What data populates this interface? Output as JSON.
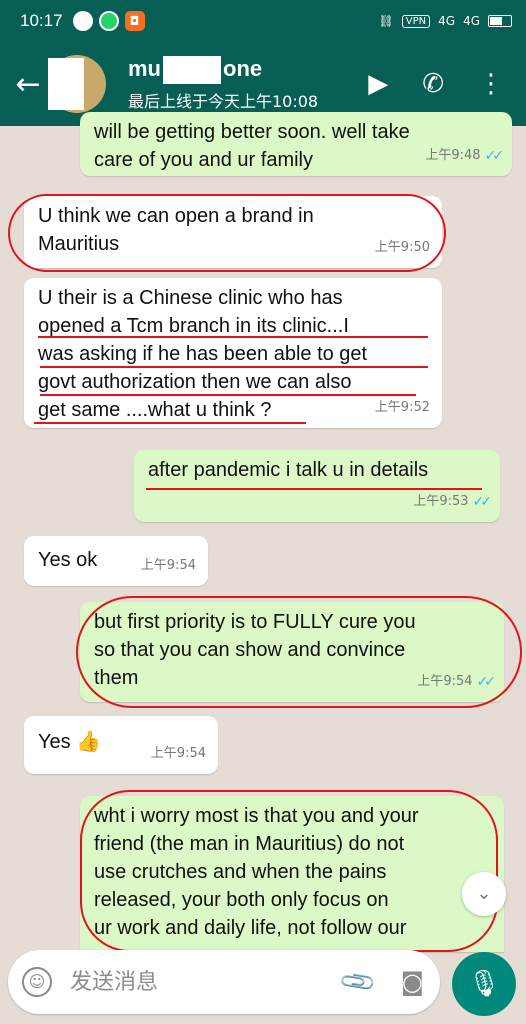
{
  "status_bar": {
    "time": "10:17",
    "vpn": "VPN",
    "net1": "4G",
    "net2": "4G"
  },
  "header": {
    "name_prefix": "mu",
    "name_suffix": "one",
    "last_seen": "最后上线于今天上午10:08",
    "icons": {
      "back": "arrow-left-icon",
      "video": "video-call-icon",
      "call": "phone-icon",
      "menu": "more-vertical-icon"
    }
  },
  "messages": [
    {
      "dir": "out",
      "text": "will be getting better soon. well take\ncare of you and ur family",
      "time": "上午9:48",
      "ticks": "✓✓"
    },
    {
      "dir": "in",
      "text": "U think we can open a brand in\nMauritius",
      "time": "上午9:50"
    },
    {
      "dir": "in",
      "text": "U their is a Chinese clinic who has\nopened a Tcm branch in its clinic...I\nwas asking if he has been able to get\ngovt authorization then we can also\nget same ....what u think ?",
      "time": "上午9:52"
    },
    {
      "dir": "out",
      "text": "after pandemic  i talk u in details",
      "time": "上午9:53",
      "ticks": "✓✓"
    },
    {
      "dir": "in",
      "text": "Yes ok",
      "time": "上午9:54"
    },
    {
      "dir": "out",
      "text": "but first priority is to FULLY cure you\nso that you can show and convince\nthem",
      "time": "上午9:54",
      "ticks": "✓✓"
    },
    {
      "dir": "in",
      "text": "Yes 👍",
      "time": "上午9:54"
    },
    {
      "dir": "out",
      "text": "wht i worry most is that you and your\nfriend (the man in Mauritius) do not\nuse crutches and when the pains\nreleased, your both only focus on\nur work and daily life, not follow our",
      "time": ""
    }
  ],
  "input": {
    "placeholder": "发送消息"
  },
  "colors": {
    "header": "#075e54",
    "incoming": "#ffffff",
    "outgoing": "#dcf8c6",
    "wallpaper": "#e5ddd5",
    "annotation": "#e0151b",
    "mic_button": "#00897b"
  }
}
